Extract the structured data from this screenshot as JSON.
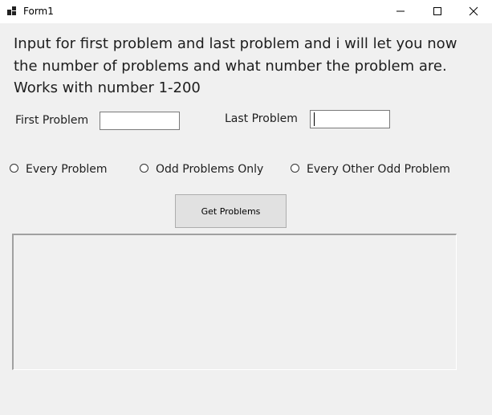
{
  "window": {
    "title": "Form1",
    "icon": "app-icon",
    "controls": [
      "minimize-icon",
      "maximize-icon",
      "close-icon"
    ]
  },
  "instructions": {
    "line1": "Input for first problem and last problem and i will let you now",
    "line2": "the number of problems and what number the problem are.",
    "line3": "Works with number 1-200"
  },
  "inputs": {
    "first_label": "First Problem",
    "first_value": "",
    "last_label": "Last Problem",
    "last_value": ""
  },
  "options": {
    "every": "Every Problem",
    "odd": "Odd Problems Only",
    "every_other_odd": "Every Other Odd Problem"
  },
  "button": {
    "label": "Get Problems"
  },
  "output": {
    "text": ""
  }
}
